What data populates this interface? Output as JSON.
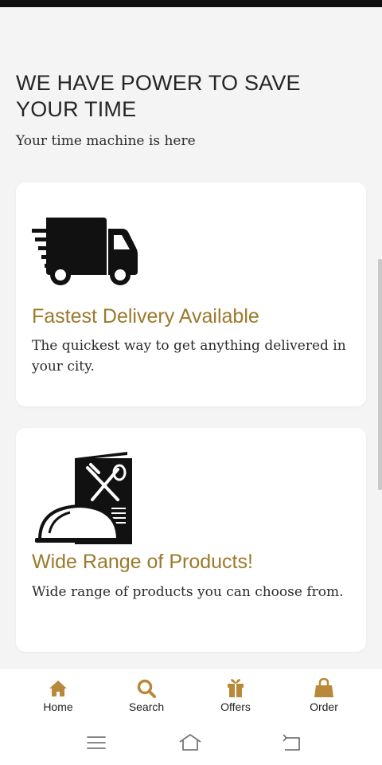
{
  "hero": {
    "title": "WE HAVE POWER TO SAVE YOUR TIME",
    "subtitle": "Your time machine is here"
  },
  "cards": [
    {
      "icon": "delivery-truck-icon",
      "title": "Fastest Delivery Available",
      "description": "The quickest way to get anything delivered in your city."
    },
    {
      "icon": "food-cloche-menu-icon",
      "title": "Wide Range of Products!",
      "description": "Wide range of products you can choose from."
    }
  ],
  "bottom_nav": {
    "items": [
      {
        "label": "Home",
        "icon": "home-icon"
      },
      {
        "label": "Search",
        "icon": "search-icon"
      },
      {
        "label": "Offers",
        "icon": "gift-icon"
      },
      {
        "label": "Order",
        "icon": "shopping-bag-icon"
      }
    ]
  },
  "system_nav": {
    "buttons": [
      "menu-icon",
      "home-outline-icon",
      "back-icon"
    ]
  },
  "colors": {
    "accent": "#9b7a2b",
    "background": "#f4f4f5",
    "card": "#ffffff",
    "text": "#262626",
    "status_bar": "#111111"
  }
}
